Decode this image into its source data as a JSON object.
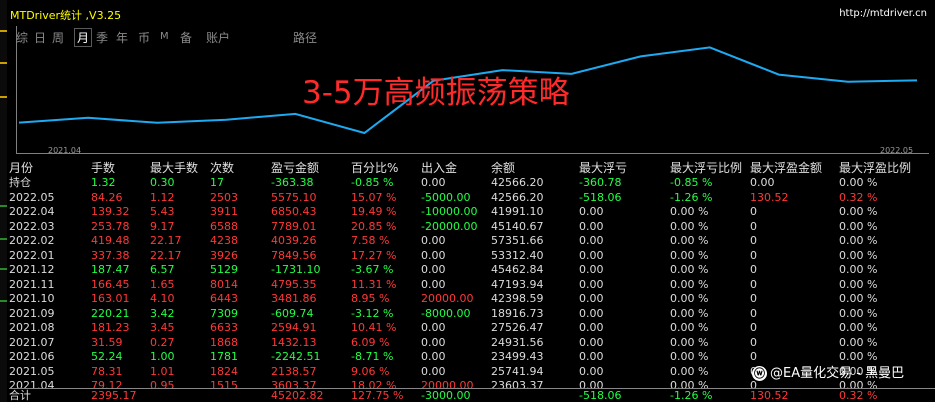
{
  "window": {
    "title": "MTDriver统计 ,V3.25",
    "url": "http://mtdriver.cn"
  },
  "tabs": [
    "综",
    "日",
    "周",
    "月",
    "季",
    "年",
    "币",
    "M",
    "备",
    "账户",
    "路径"
  ],
  "active_tab": "月",
  "chart_data": {
    "type": "line",
    "title": "3-5万高频振荡策略",
    "x_start_label": "2021.04",
    "x_end_label": "2022.05",
    "x": [
      "2021.04",
      "2021.05",
      "2021.06",
      "2021.07",
      "2021.08",
      "2021.09",
      "2021.10",
      "2021.11",
      "2021.12",
      "2022.01",
      "2022.02",
      "2022.03",
      "2022.04",
      "2022.05"
    ],
    "y": [
      23603.37,
      25741.94,
      23499.43,
      24931.56,
      27526.47,
      18916.73,
      42398.59,
      47193.94,
      45462.84,
      53312.4,
      57351.66,
      45140.67,
      41991.1,
      42566.2
    ],
    "color": "#1eaaf0"
  },
  "table": {
    "headers": [
      "月份",
      "手数",
      "最大手数",
      "次数",
      "盈亏金额",
      "百分比%",
      "出入金",
      "余额",
      "最大浮亏",
      "最大浮亏比例",
      "最大浮盈金额",
      "最大浮盈比例"
    ],
    "rows": [
      {
        "cells": [
          "持仓",
          "1.32",
          "0.30",
          "17",
          "-363.38",
          "-0.85 %",
          "0.00",
          "42566.20",
          "-360.78",
          "-0.85 %",
          "0.00",
          "0.00 %"
        ],
        "colors": [
          "white",
          "green",
          "green",
          "green",
          "green",
          "green",
          "white",
          "white",
          "green",
          "green",
          "white",
          "white"
        ]
      },
      {
        "cells": [
          "2022.05",
          "84.26",
          "1.12",
          "2503",
          "5575.10",
          "15.07 %",
          "-5000.00",
          "42566.20",
          "-518.06",
          "-1.26 %",
          "130.52",
          "0.32 %"
        ],
        "colors": [
          "white",
          "red",
          "red",
          "red",
          "red",
          "red",
          "green",
          "white",
          "green",
          "green",
          "red",
          "red"
        ]
      },
      {
        "cells": [
          "2022.04",
          "139.32",
          "5.43",
          "3911",
          "6850.43",
          "19.49 %",
          "-10000.00",
          "41991.10",
          "0.00",
          "0.00 %",
          "0",
          "0.00 %"
        ],
        "colors": [
          "white",
          "red",
          "red",
          "red",
          "red",
          "red",
          "green",
          "white",
          "white",
          "white",
          "white",
          "white"
        ]
      },
      {
        "cells": [
          "2022.03",
          "253.78",
          "9.17",
          "6588",
          "7789.01",
          "20.85 %",
          "-20000.00",
          "45140.67",
          "0.00",
          "0.00 %",
          "0",
          "0.00 %"
        ],
        "colors": [
          "white",
          "red",
          "red",
          "red",
          "red",
          "red",
          "green",
          "white",
          "white",
          "white",
          "white",
          "white"
        ]
      },
      {
        "cells": [
          "2022.02",
          "419.48",
          "22.17",
          "4238",
          "4039.26",
          "7.58 %",
          "0.00",
          "57351.66",
          "0.00",
          "0.00 %",
          "0",
          "0.00 %"
        ],
        "colors": [
          "white",
          "red",
          "red",
          "red",
          "red",
          "red",
          "white",
          "white",
          "white",
          "white",
          "white",
          "white"
        ]
      },
      {
        "cells": [
          "2022.01",
          "337.38",
          "22.17",
          "3926",
          "7849.56",
          "17.27 %",
          "0.00",
          "53312.40",
          "0.00",
          "0.00 %",
          "0",
          "0.00 %"
        ],
        "colors": [
          "white",
          "red",
          "red",
          "red",
          "red",
          "red",
          "white",
          "white",
          "white",
          "white",
          "white",
          "white"
        ]
      },
      {
        "cells": [
          "2021.12",
          "187.47",
          "6.57",
          "5129",
          "-1731.10",
          "-3.67 %",
          "0.00",
          "45462.84",
          "0.00",
          "0.00 %",
          "0",
          "0.00 %"
        ],
        "colors": [
          "white",
          "green",
          "green",
          "green",
          "green",
          "green",
          "white",
          "white",
          "white",
          "white",
          "white",
          "white"
        ]
      },
      {
        "cells": [
          "2021.11",
          "166.45",
          "1.65",
          "8014",
          "4795.35",
          "11.31 %",
          "0.00",
          "47193.94",
          "0.00",
          "0.00 %",
          "0",
          "0.00 %"
        ],
        "colors": [
          "white",
          "red",
          "red",
          "red",
          "red",
          "red",
          "white",
          "white",
          "white",
          "white",
          "white",
          "white"
        ]
      },
      {
        "cells": [
          "2021.10",
          "163.01",
          "4.10",
          "6443",
          "3481.86",
          "8.95 %",
          "20000.00",
          "42398.59",
          "0.00",
          "0.00 %",
          "0",
          "0.00 %"
        ],
        "colors": [
          "white",
          "red",
          "red",
          "red",
          "red",
          "red",
          "red",
          "white",
          "white",
          "white",
          "white",
          "white"
        ]
      },
      {
        "cells": [
          "2021.09",
          "220.21",
          "3.42",
          "7309",
          "-609.74",
          "-3.12 %",
          "-8000.00",
          "18916.73",
          "0.00",
          "0.00 %",
          "0",
          "0.00 %"
        ],
        "colors": [
          "white",
          "green",
          "green",
          "green",
          "green",
          "green",
          "green",
          "white",
          "white",
          "white",
          "white",
          "white"
        ]
      },
      {
        "cells": [
          "2021.08",
          "181.23",
          "3.45",
          "6633",
          "2594.91",
          "10.41 %",
          "0.00",
          "27526.47",
          "0.00",
          "0.00 %",
          "0",
          "0.00 %"
        ],
        "colors": [
          "white",
          "red",
          "red",
          "red",
          "red",
          "red",
          "white",
          "white",
          "white",
          "white",
          "white",
          "white"
        ]
      },
      {
        "cells": [
          "2021.07",
          "31.59",
          "0.27",
          "1868",
          "1432.13",
          "6.09 %",
          "0.00",
          "24931.56",
          "0.00",
          "0.00 %",
          "0",
          "0.00 %"
        ],
        "colors": [
          "white",
          "red",
          "red",
          "red",
          "red",
          "red",
          "white",
          "white",
          "white",
          "white",
          "white",
          "white"
        ]
      },
      {
        "cells": [
          "2021.06",
          "52.24",
          "1.00",
          "1781",
          "-2242.51",
          "-8.71 %",
          "0.00",
          "23499.43",
          "0.00",
          "0.00 %",
          "0",
          "0.00 %"
        ],
        "colors": [
          "white",
          "green",
          "green",
          "green",
          "green",
          "green",
          "white",
          "white",
          "white",
          "white",
          "white",
          "white"
        ]
      },
      {
        "cells": [
          "2021.05",
          "78.31",
          "1.01",
          "1824",
          "2138.57",
          "9.06 %",
          "0.00",
          "25741.94",
          "0.00",
          "0.00 %",
          "0",
          "0.00 %"
        ],
        "colors": [
          "white",
          "red",
          "red",
          "red",
          "red",
          "red",
          "white",
          "white",
          "white",
          "white",
          "white",
          "white"
        ]
      },
      {
        "cells": [
          "2021.04",
          "79.12",
          "0.95",
          "1515",
          "3603.37",
          "18.02 %",
          "20000.00",
          "23603.37",
          "0.00",
          "0.00 %",
          "0",
          "0.00 %"
        ],
        "colors": [
          "white",
          "red",
          "red",
          "red",
          "red",
          "red",
          "red",
          "white",
          "white",
          "white",
          "white",
          "white"
        ]
      }
    ],
    "total": {
      "cells": [
        "合计",
        "2395.17",
        "",
        "",
        "45202.82",
        "127.75 %",
        "-3000.00",
        "",
        "-518.06",
        "-1.26 %",
        "130.52",
        "0.32 %"
      ],
      "colors": [
        "white",
        "red",
        "white",
        "white",
        "red",
        "red",
        "green",
        "white",
        "green",
        "green",
        "red",
        "red"
      ]
    }
  },
  "watermark": "@EA量化交易 - 黑曼巴",
  "watermark_icon": "weibo-icon"
}
